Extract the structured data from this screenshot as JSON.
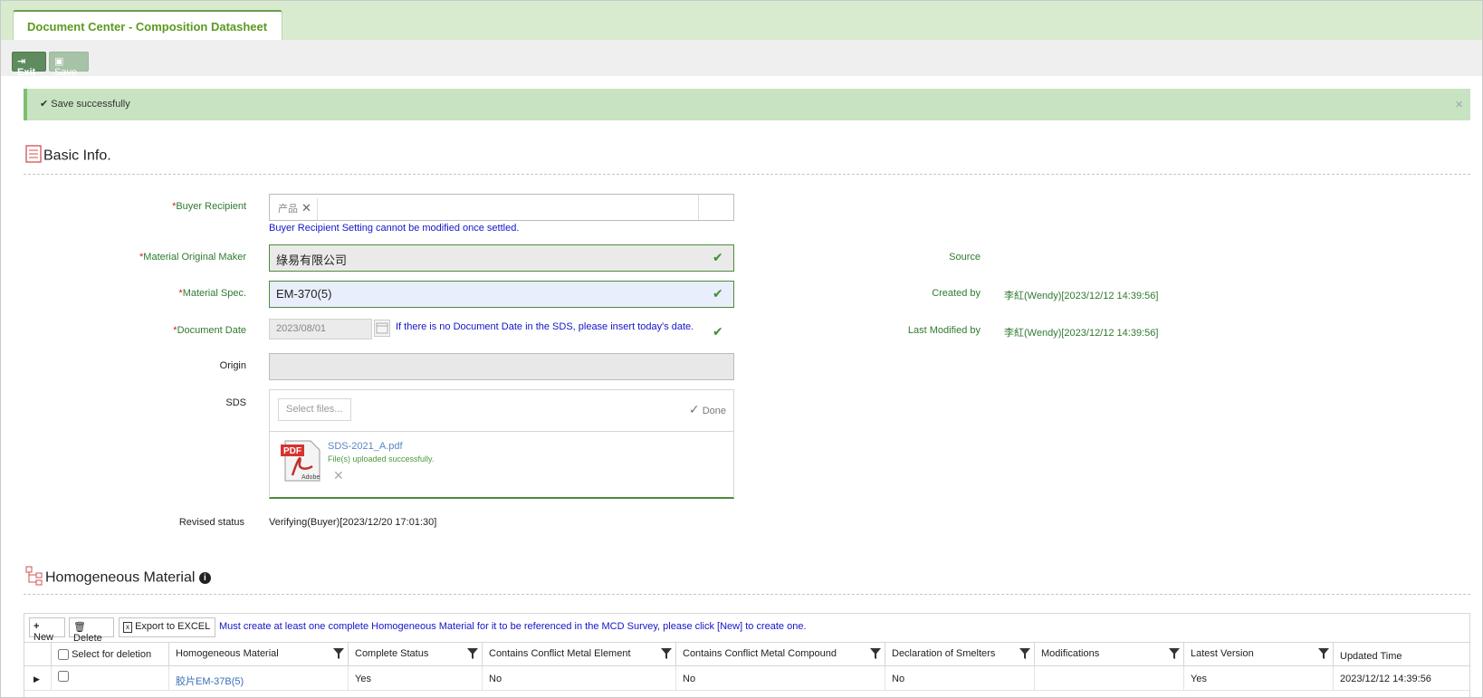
{
  "tab": {
    "title": "Document Center - Composition Datasheet"
  },
  "toolbar": {
    "exit_label": "Exit",
    "save_label": "Save"
  },
  "alert": {
    "message": "Save successfully",
    "close": "×"
  },
  "basic_info": {
    "title": "Basic Info.",
    "buyer_recipient": {
      "label": "Buyer Recipient",
      "chip": "产品",
      "note": "Buyer Recipient Setting cannot be modified once settled."
    },
    "material_original_maker": {
      "label": "Material Original Maker",
      "value": "綠易有限公司"
    },
    "material_spec": {
      "label": "Material Spec.",
      "value": "EM-370(5)"
    },
    "document_date": {
      "label": "Document Date",
      "value": "2023/08/01",
      "note": "If there is no Document Date in the SDS, please insert today's date."
    },
    "origin": {
      "label": "Origin",
      "value": ""
    },
    "sds": {
      "label": "SDS",
      "select_placeholder": "Select files...",
      "done_label": "Done",
      "file_name": "SDS-2021_A.pdf",
      "file_status": "File(s) uploaded successfully."
    },
    "revised_status": {
      "label": "Revised status",
      "value": "Verifying(Buyer)[2023/12/20 17:01:30]"
    },
    "source": {
      "label": "Source",
      "value": ""
    },
    "created_by": {
      "label": "Created by",
      "value": "李紅(Wendy)[2023/12/12 14:39:56]"
    },
    "last_modified_by": {
      "label": "Last Modified by",
      "value": "李紅(Wendy)[2023/12/12 14:39:56]"
    }
  },
  "homogeneous": {
    "title": "Homogeneous Material",
    "new_label": "New",
    "delete_label": "Delete",
    "export_label": "Export to EXCEL",
    "note": "Must create at least one complete Homogeneous Material for it to be referenced in the MCD Survey, please click [New] to create one.",
    "columns": [
      "Select for deletion",
      "Homogeneous Material",
      "Complete Status",
      "Contains Conflict Metal Element",
      "Contains Conflict Metal Compound",
      "Declaration of Smelters",
      "Modifications",
      "Latest Version",
      "Updated Time"
    ],
    "rows": [
      {
        "material": "胶片EM-37B(5)",
        "complete_status": "Yes",
        "conflict_element": "No",
        "conflict_compound": "No",
        "declaration": "No",
        "modifications": "",
        "latest_version": "Yes",
        "updated_time": "2023/12/12 14:39:56"
      }
    ]
  },
  "colors": {
    "accent_green": "#5a9a1e",
    "label_green": "#2f7a2f",
    "note_blue": "#1515c8",
    "required_red": "#d02020"
  }
}
